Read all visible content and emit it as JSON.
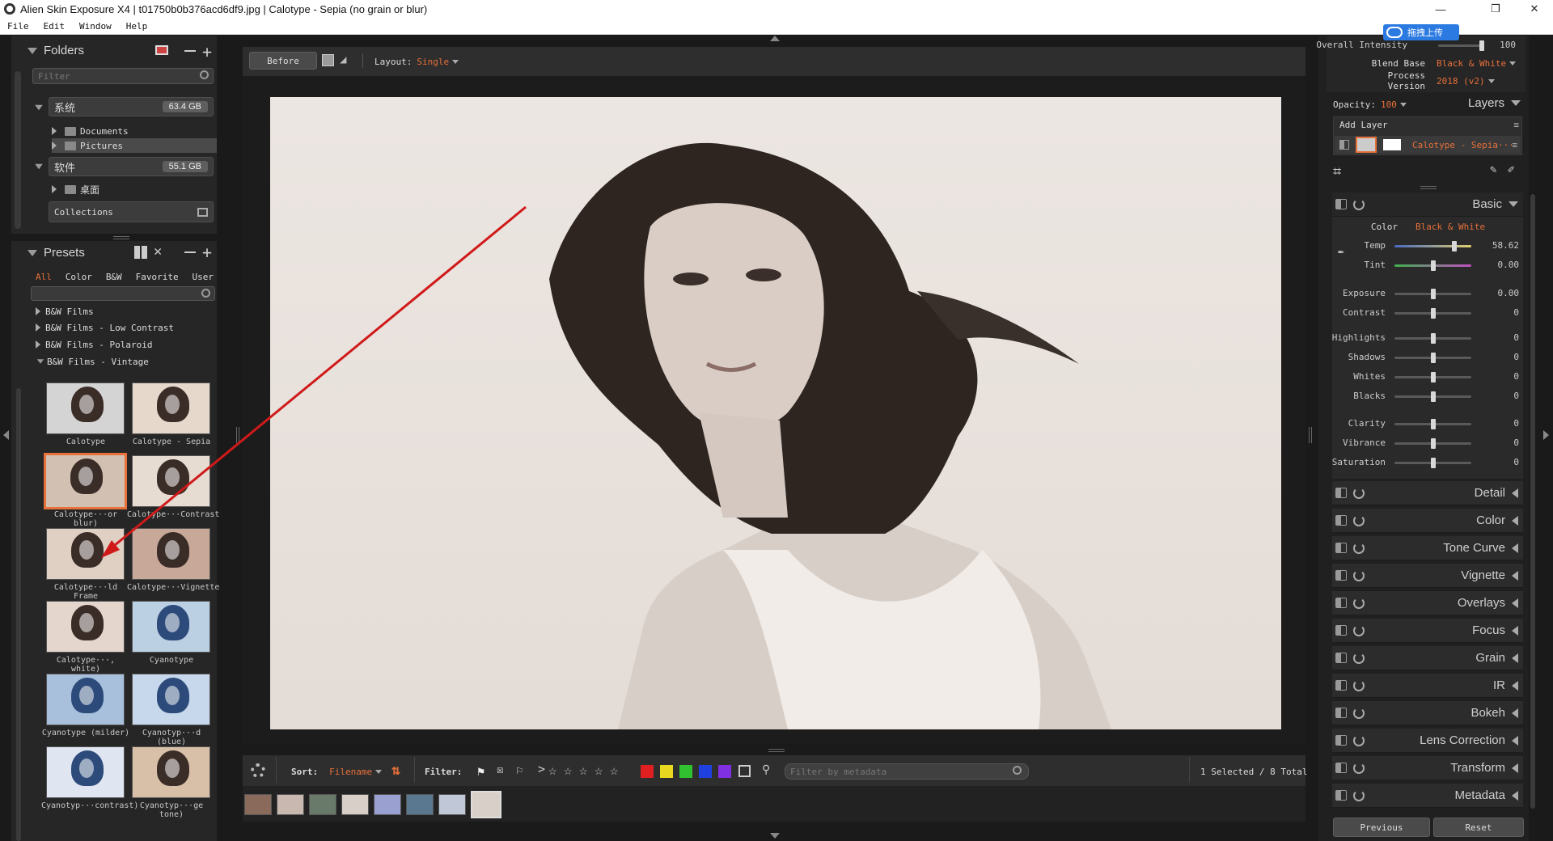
{
  "window": {
    "title": "Alien Skin Exposure X4 | t01750b0b376acd6df9.jpg | Calotype - Sepia (no grain or blur)",
    "controls": [
      "—",
      "❐",
      "✕"
    ]
  },
  "menu": [
    "File",
    "Edit",
    "Window",
    "Help"
  ],
  "folders": {
    "title": "Folders",
    "filter_placeholder": "Filter",
    "drives": [
      {
        "name": "系统",
        "size": "63.4 GB"
      },
      {
        "name": "软件",
        "size": "55.1 GB"
      }
    ],
    "items": [
      "Documents",
      "Pictures",
      "桌面"
    ],
    "collections": "Collections"
  },
  "presets": {
    "title": "Presets",
    "tabs": [
      "All",
      "Color",
      "B&W",
      "Favorite",
      "User"
    ],
    "groups": [
      "B&W Films",
      "B&W Films - Low Contrast",
      "B&W Films - Polaroid",
      "B&W Films - Vintage"
    ],
    "thumbs": [
      "Calotype",
      "Calotype - Sepia",
      "Calotype···or blur)",
      "Calotype···Contrast",
      "Calotype···ld Frame",
      "Calotype···Vignette",
      "Calotype···, white)",
      "Cyanotype",
      "Cyanotype (milder)",
      "Cyanotyp···d (blue)",
      "Cyanotyp···contrast)",
      "Cyanotyp···ge tone)"
    ]
  },
  "top_toolbar": {
    "before": "Before",
    "layout_label": "Layout:",
    "layout_value": "Single"
  },
  "bottom_toolbar": {
    "sort_label": "Sort:",
    "sort_value": "Filename",
    "filter_label": "Filter:",
    "metadata_placeholder": "Filter by metadata",
    "count": "1 Selected / 8 Total",
    "colors": [
      "#e02020",
      "#e8d820",
      "#30c030",
      "#2040e0",
      "#8030e0"
    ]
  },
  "right": {
    "overall_intensity_label": "Overall Intensity",
    "overall_intensity_value": "100",
    "overall_intensity_level": 100,
    "blend_base_label": "Blend Base",
    "blend_base_value": "Black & White",
    "process_version_label": "Process Version",
    "process_version_value": "2018 (v2)",
    "opacity_label": "Opacity:",
    "opacity_value": "100",
    "layers_label": "Layers",
    "add_layer": "Add Layer",
    "layer_name": "Calotype - Sepia···",
    "basic_title": "Basic",
    "color_label": "Color",
    "color_value": "Black & White",
    "sliders": [
      {
        "label": "Temp",
        "value": "58.62",
        "pos": 0.78
      },
      {
        "label": "Tint",
        "value": "0.00",
        "pos": 0.5
      },
      {
        "label": "Exposure",
        "value": "0.00",
        "pos": 0.5
      },
      {
        "label": "Contrast",
        "value": "0",
        "pos": 0.5
      },
      {
        "label": "Highlights",
        "value": "0",
        "pos": 0.5
      },
      {
        "label": "Shadows",
        "value": "0",
        "pos": 0.5
      },
      {
        "label": "Whites",
        "value": "0",
        "pos": 0.5
      },
      {
        "label": "Blacks",
        "value": "0",
        "pos": 0.5
      },
      {
        "label": "Clarity",
        "value": "0",
        "pos": 0.5
      },
      {
        "label": "Vibrance",
        "value": "0",
        "pos": 0.5
      },
      {
        "label": "Saturation",
        "value": "0",
        "pos": 0.5
      }
    ],
    "sections": [
      "Detail",
      "Color",
      "Tone Curve",
      "Vignette",
      "Overlays",
      "Focus",
      "Grain",
      "IR",
      "Bokeh",
      "Lens Correction",
      "Transform",
      "Metadata"
    ],
    "previous": "Previous",
    "reset": "Reset"
  },
  "upload_badge": "拖拽上传"
}
